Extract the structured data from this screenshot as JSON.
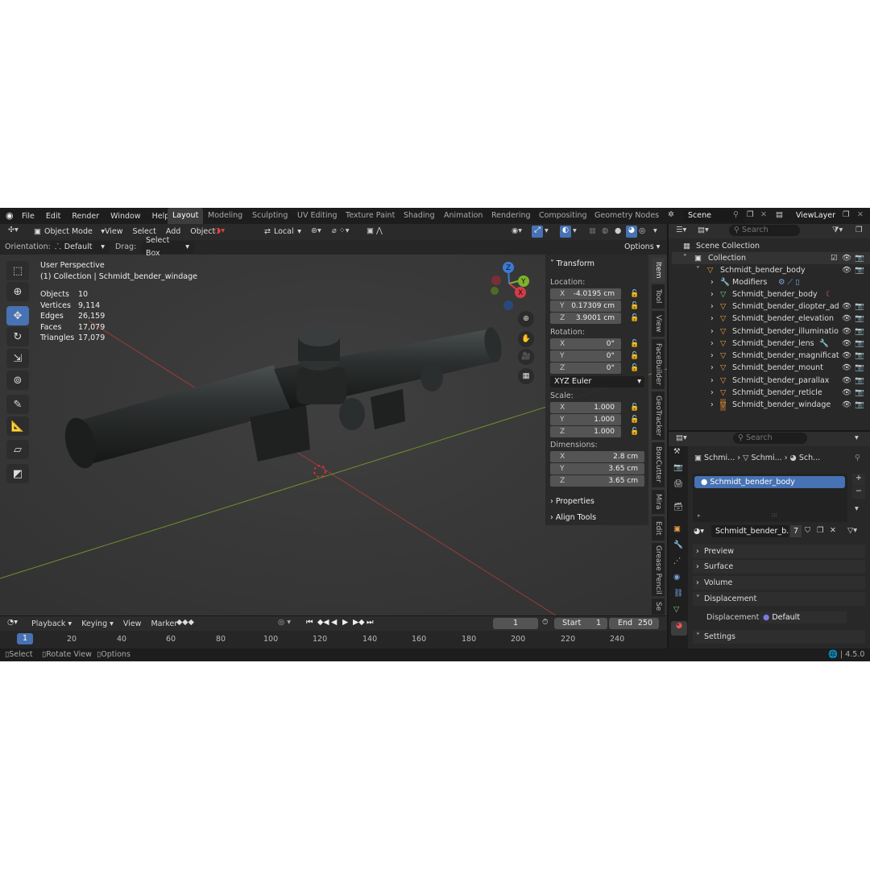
{
  "menu": [
    "File",
    "Edit",
    "Render",
    "Window",
    "Help"
  ],
  "workspaces": [
    "Layout",
    "Modeling",
    "Sculpting",
    "UV Editing",
    "Texture Paint",
    "Shading",
    "Animation",
    "Rendering",
    "Compositing",
    "Geometry Nodes"
  ],
  "scene": {
    "name": "Scene",
    "view_layer": "ViewLayer"
  },
  "header": {
    "mode": "Object Mode",
    "items": [
      "View",
      "Select",
      "Add",
      "Object"
    ],
    "transform_space": "Local"
  },
  "header2": {
    "orientation_label": "Orientation:",
    "orientation": "Default",
    "drag_label": "Drag:",
    "drag": "Select Box",
    "options": "Options"
  },
  "viewport": {
    "perspective": "User Perspective",
    "collection": "(1) Collection | Schmidt_bender_windage"
  },
  "stats": [
    {
      "label": "Objects",
      "value": "10"
    },
    {
      "label": "Vertices",
      "value": "9,114"
    },
    {
      "label": "Edges",
      "value": "26,159"
    },
    {
      "label": "Faces",
      "value": "17,079"
    },
    {
      "label": "Triangles",
      "value": "17,079"
    }
  ],
  "gizmo": {
    "x": "X",
    "y": "Y",
    "z": "Z"
  },
  "npanel": {
    "title": "Transform",
    "location_label": "Location:",
    "location": [
      {
        "axis": "X",
        "value": "-4.0195 cm"
      },
      {
        "axis": "Y",
        "value": "0.17309 cm"
      },
      {
        "axis": "Z",
        "value": "3.9001 cm"
      }
    ],
    "rotation_label": "Rotation:",
    "rotation": [
      {
        "axis": "X",
        "value": "0°"
      },
      {
        "axis": "Y",
        "value": "0°"
      },
      {
        "axis": "Z",
        "value": "0°"
      }
    ],
    "rotation_mode": "XYZ Euler",
    "scale_label": "Scale:",
    "scale": [
      {
        "axis": "X",
        "value": "1.000"
      },
      {
        "axis": "Y",
        "value": "1.000"
      },
      {
        "axis": "Z",
        "value": "1.000"
      }
    ],
    "dimensions_label": "Dimensions:",
    "dimensions": [
      {
        "axis": "X",
        "value": "2.8 cm"
      },
      {
        "axis": "Y",
        "value": "3.65 cm"
      },
      {
        "axis": "Z",
        "value": "3.65 cm"
      }
    ],
    "properties": "Properties",
    "align_tools": "Align Tools"
  },
  "side_tabs": [
    "Item",
    "Tool",
    "View",
    "FaceBuilder",
    "GeoTracker",
    "BoxCutter",
    "Mira",
    "Edit",
    "Grease Pencil",
    "Se"
  ],
  "outliner": {
    "search_placeholder": "Search",
    "scene_collection": "Scene Collection",
    "collection": "Collection",
    "body": "Schmidt_bender_body",
    "modifiers": "Modifiers",
    "mesh": "Schmidt_bender_body",
    "objects": [
      "Schmidt_bender_diopter_ad",
      "Schmidt_bender_elevation",
      "Schmidt_bender_illuminatio",
      "Schmidt_bender_lens",
      "Schmidt_bender_magnificat",
      "Schmidt_bender_mount",
      "Schmidt_bender_parallax",
      "Schmidt_bender_reticle",
      "Schmidt_bender_windage"
    ]
  },
  "properties": {
    "search_placeholder": "Search",
    "breadcrumb": [
      "Schmi...",
      "Schmi...",
      "Sch..."
    ],
    "material_slot": "Schmidt_bender_body",
    "material_name": "Schmidt_bender_b...",
    "users": "7",
    "sections": [
      "Preview",
      "Surface",
      "Volume",
      "Displacement"
    ],
    "displacement_label": "Displacement",
    "displacement_value": "Default",
    "settings": "Settings"
  },
  "timeline": {
    "menu": [
      "Playback",
      "Keying",
      "View",
      "Marker"
    ],
    "current_frame": "1",
    "start_label": "Start",
    "start": "1",
    "end_label": "End",
    "end": "250",
    "ticks": [
      "1",
      "20",
      "40",
      "60",
      "80",
      "100",
      "120",
      "140",
      "160",
      "180",
      "200",
      "220",
      "240"
    ]
  },
  "status": {
    "select": "Select",
    "rotate": "Rotate View",
    "options": "Options",
    "version": "4.5.0"
  }
}
